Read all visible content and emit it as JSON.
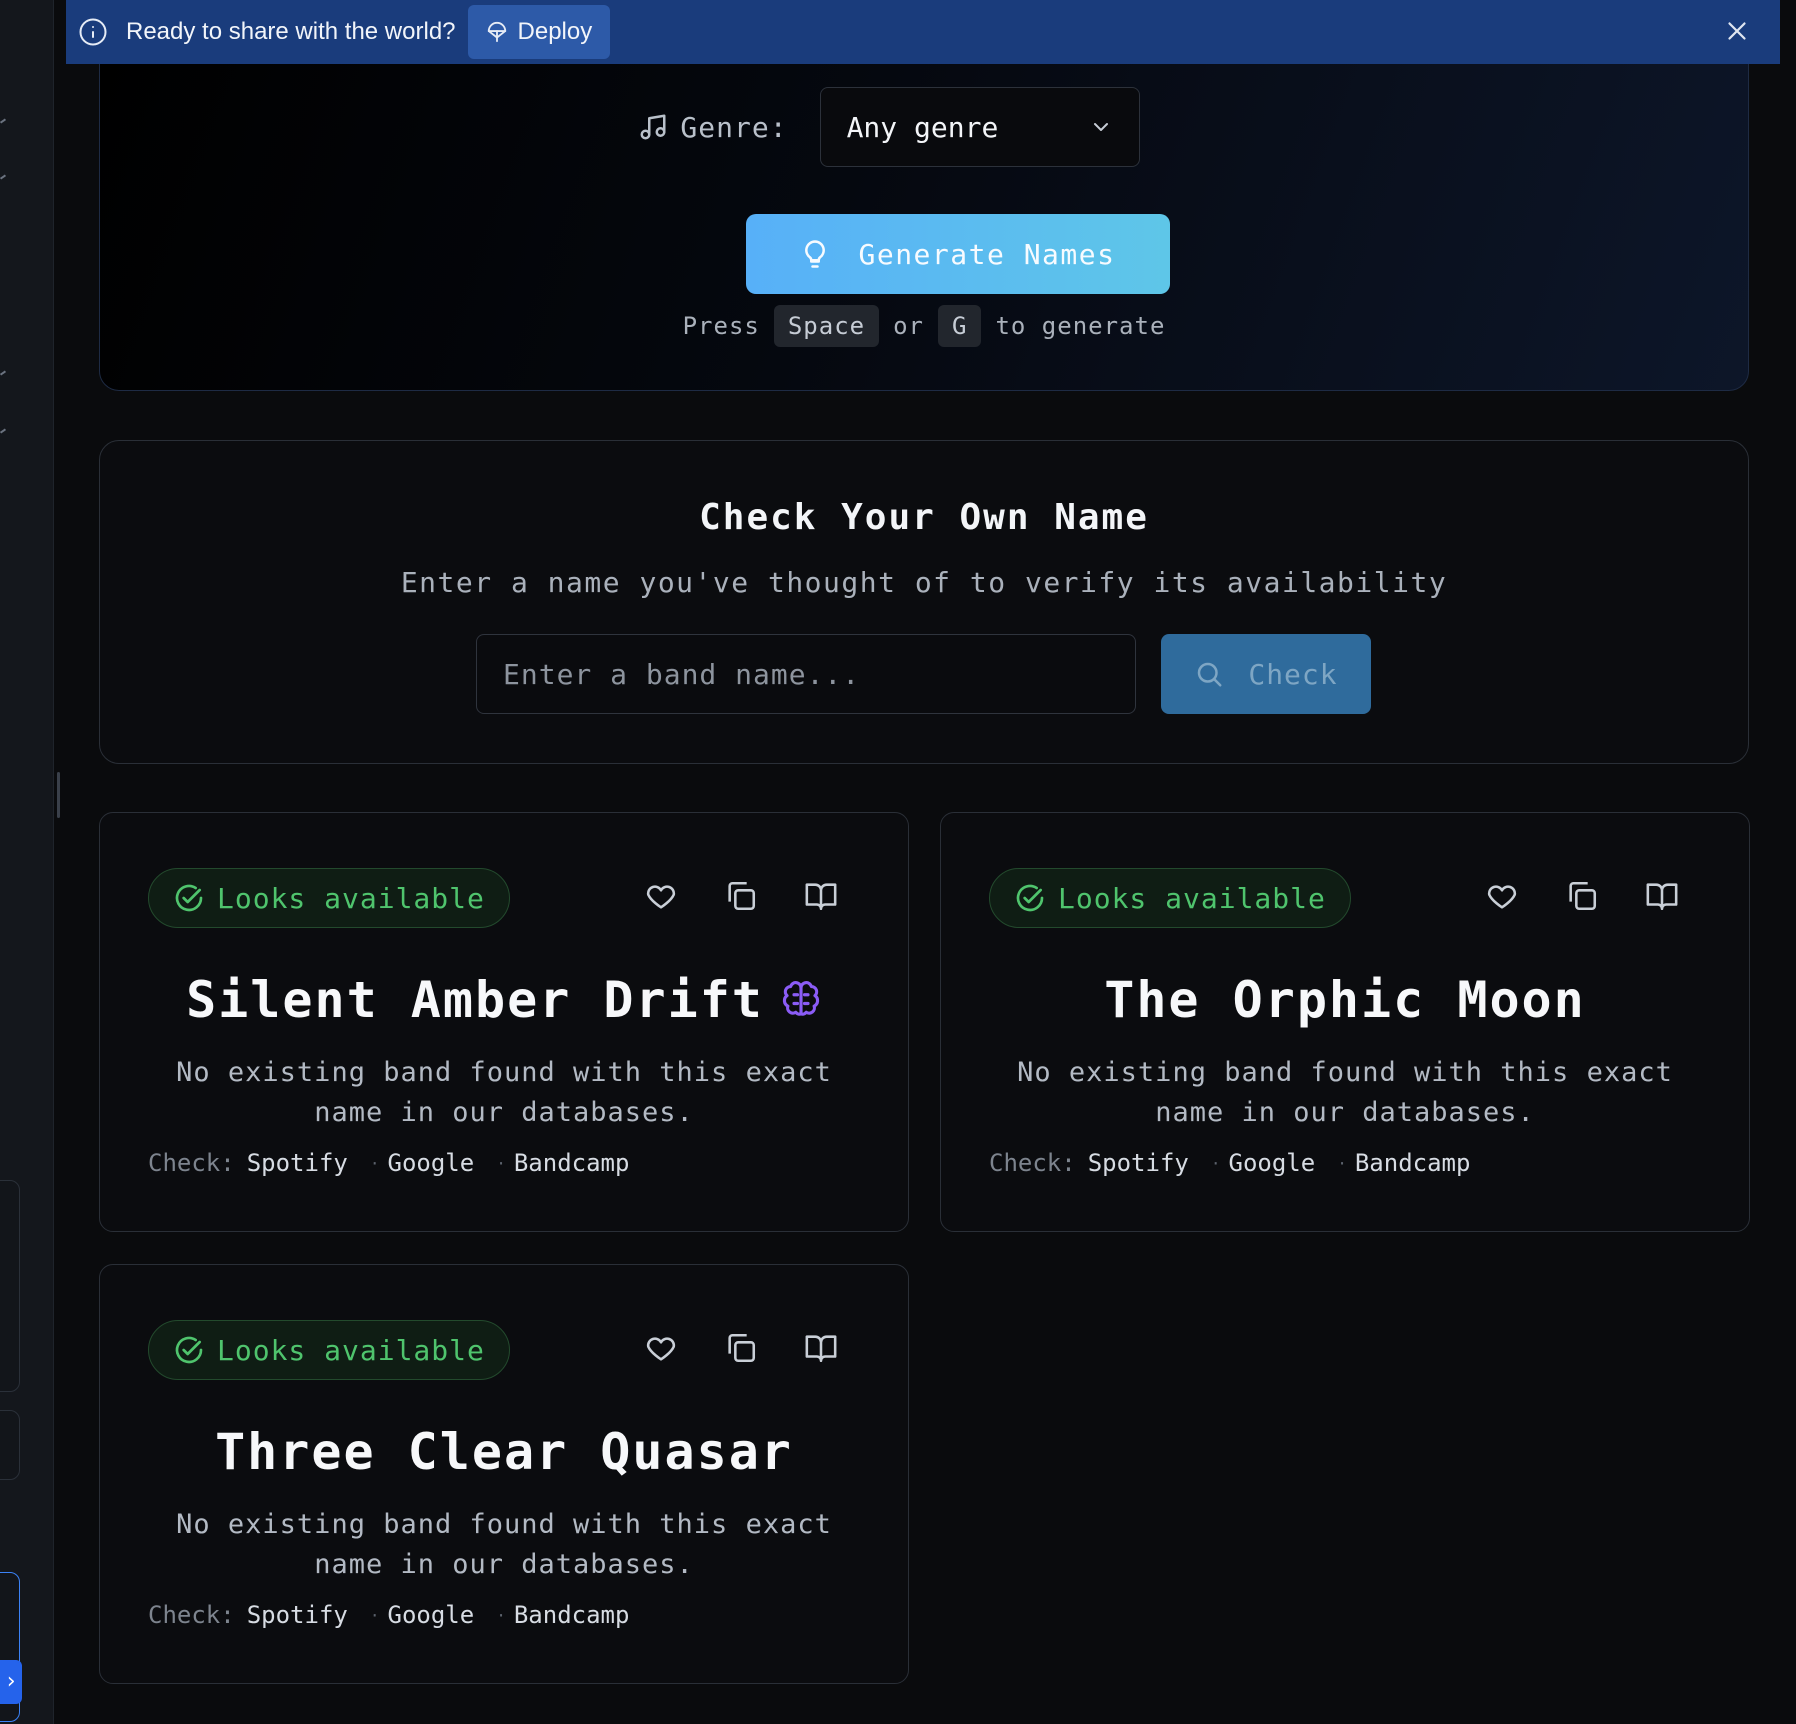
{
  "banner": {
    "text": "Ready to share with the world?",
    "deploy_label": "Deploy"
  },
  "generator": {
    "genre_label": "Genre:",
    "genre_value": "Any genre",
    "generate_label": "Generate Names",
    "hint_press": "Press",
    "hint_key1": "Space",
    "hint_or": "or",
    "hint_key2": "G",
    "hint_suffix": "to generate"
  },
  "check": {
    "title": "Check Your Own Name",
    "subtitle": "Enter a name you've thought of to verify its availability",
    "input_placeholder": "Enter a band name...",
    "input_value": "",
    "button_label": "Check"
  },
  "results": [
    {
      "status": "Looks available",
      "name": "Silent Amber Drift",
      "ai_icon": "brain-icon",
      "desc": "No existing band found with this exact name in our databases.",
      "check_label": "Check:",
      "links": [
        "Spotify",
        "Google",
        "Bandcamp"
      ]
    },
    {
      "status": "Looks available",
      "name": "The Orphic Moon",
      "desc": "No existing band found with this exact name in our databases.",
      "check_label": "Check:",
      "links": [
        "Spotify",
        "Google",
        "Bandcamp"
      ]
    },
    {
      "status": "Looks available",
      "name": "Three Clear Quasar",
      "desc": "No existing band found with this exact name in our databases.",
      "check_label": "Check:",
      "links": [
        "Spotify",
        "Google",
        "Bandcamp"
      ]
    }
  ],
  "colors": {
    "banner": "#1a3c7c",
    "generate": "#57b0f8",
    "available": "#4fc46d",
    "brain": "#8b5cf6"
  }
}
